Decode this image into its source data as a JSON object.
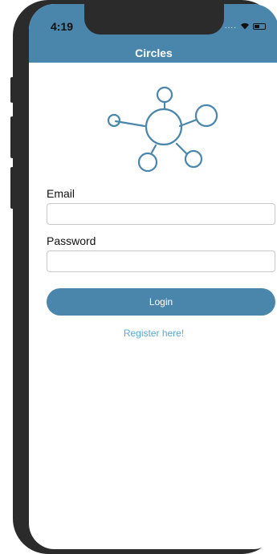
{
  "status_bar": {
    "time": "4:19",
    "signal_dots": "....",
    "icons": [
      "wifi-icon",
      "battery-icon"
    ]
  },
  "nav": {
    "title": "Circles"
  },
  "logo": {
    "icon": "network-circles-icon"
  },
  "form": {
    "email_label": "Email",
    "email_value": "",
    "password_label": "Password",
    "password_value": "",
    "login_label": "Login",
    "register_link": "Register here!"
  },
  "colors": {
    "brand": "#4a86ab",
    "link": "#5aa6dc",
    "device": "#2b2b2b"
  }
}
